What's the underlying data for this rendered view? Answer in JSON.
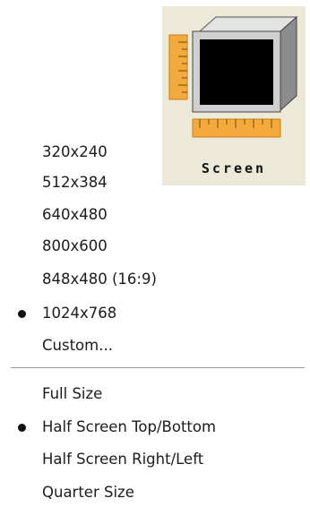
{
  "screen_button": {
    "caption": "Screen",
    "icon": "monitor-with-rulers-icon"
  },
  "resolution_menu": {
    "items": [
      {
        "label": "320x240",
        "selected": false
      },
      {
        "label": "512x384",
        "selected": false
      },
      {
        "label": "640x480",
        "selected": false
      },
      {
        "label": "800x600",
        "selected": false
      },
      {
        "label": "848x480 (16:9)",
        "selected": false
      },
      {
        "label": "1024x768",
        "selected": true
      },
      {
        "label": "Custom...",
        "selected": false
      }
    ]
  },
  "view_menu": {
    "items": [
      {
        "label": "Full Size",
        "selected": false
      },
      {
        "label": "Half Screen Top/Bottom",
        "selected": true
      },
      {
        "label": "Half Screen Right/Left",
        "selected": false
      },
      {
        "label": "Quarter Size",
        "selected": false
      }
    ]
  },
  "colors": {
    "button_face": "#ece9d8",
    "ruler_orange": "#f4a93c",
    "monitor_screen": "#000000",
    "separator": "#9a9a9a"
  }
}
